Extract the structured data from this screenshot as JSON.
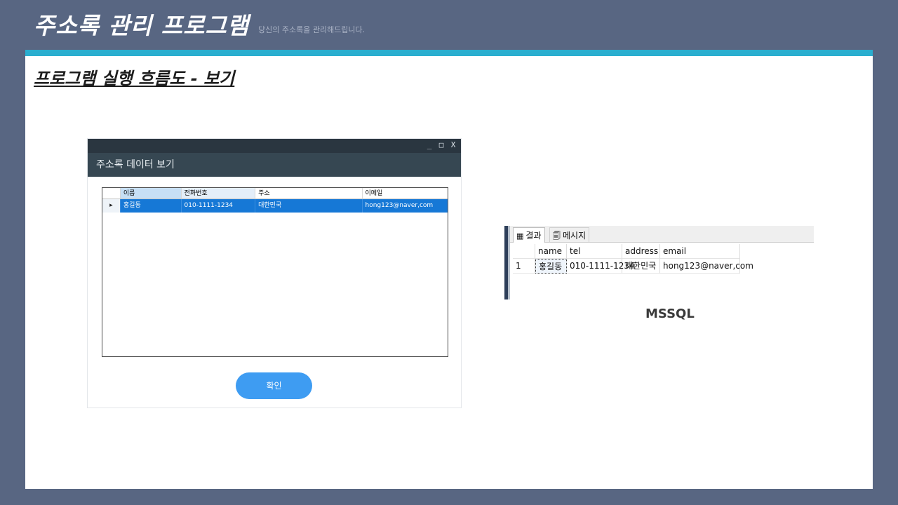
{
  "slide": {
    "title": "주소록 관리 프로그램",
    "subtitle": "당신의 주소록을 관리해드립니다.",
    "section_title": "프로그램 실행 흐름도 - 보기"
  },
  "app_window": {
    "controls": {
      "minimize": "_",
      "maximize": "□",
      "close": "X"
    },
    "header_title": "주소록 데이터 보기",
    "columns": [
      "이름",
      "전화번호",
      "주소",
      "이메일"
    ],
    "row": {
      "indicator": "▸",
      "name": "홍길동",
      "tel": "010-1111-1234",
      "address": "대한민국",
      "email": "hong123@naver,com"
    },
    "confirm_label": "확인"
  },
  "ssms": {
    "tabs": {
      "result": "결과",
      "message": "메시지"
    },
    "columns": [
      "name",
      "tel",
      "address",
      "email"
    ],
    "row": {
      "num": "1",
      "name": "홍길동",
      "tel": "010-1111-1234",
      "address": "대한민국",
      "email": "hong123@naver,com"
    },
    "caption": "MSSQL"
  },
  "colors": {
    "background": "#586682",
    "accent": "#2aaecf",
    "selected_row": "#1678d6",
    "button": "#3e9cf2"
  }
}
